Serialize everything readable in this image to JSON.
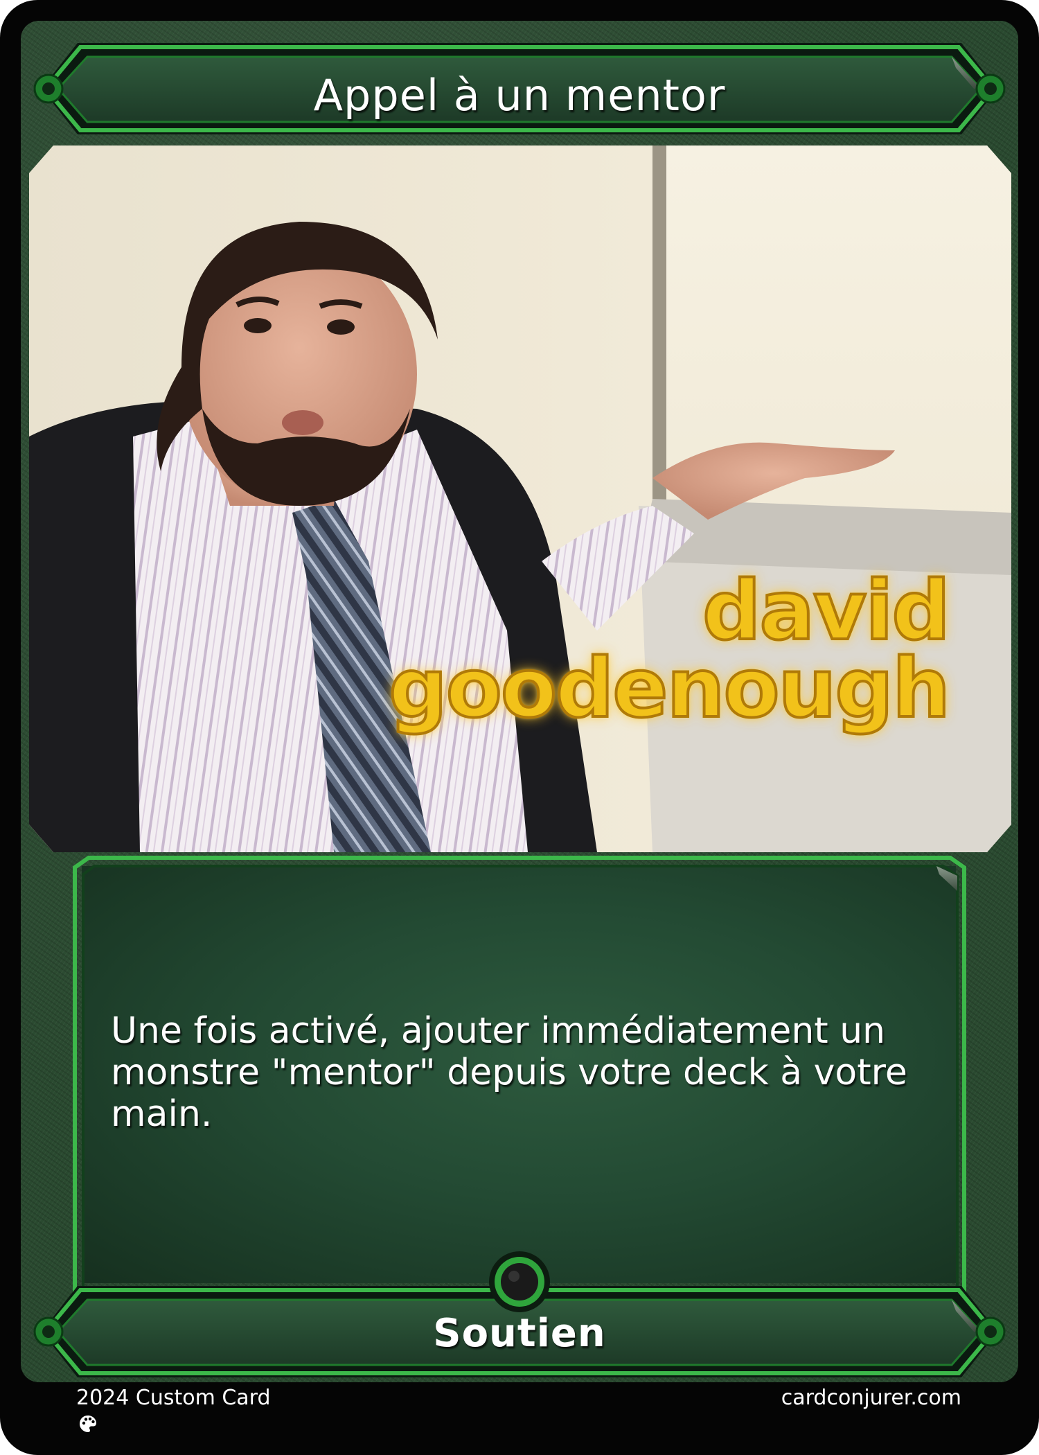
{
  "card": {
    "title": "Appel à un mentor",
    "rules_text": "Une fois activé, ajouter immédiatement un monstre \"mentor\" depuis votre deck à votre main.",
    "type_line": "Soutien",
    "art_caption": "david goodenough",
    "art_caption_line1": "david",
    "art_caption_line2": "goodenough"
  },
  "footer": {
    "left_text": "2024 Custom Card",
    "right_text": "cardconjurer.com",
    "icon": "palette-icon"
  },
  "colors": {
    "frame_green": "#2a4a30",
    "border_green": "#3cb84a",
    "text_box_green": "#234a33",
    "caption_gold": "#f2c21a"
  }
}
